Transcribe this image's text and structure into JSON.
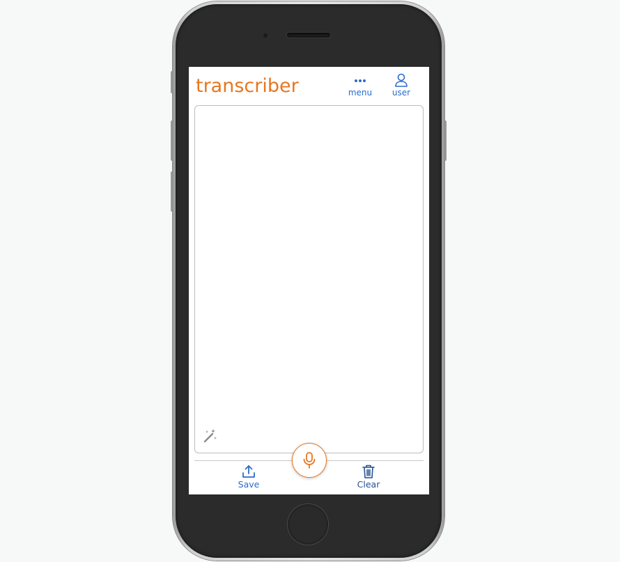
{
  "app": {
    "title": "transcriber"
  },
  "header": {
    "menu_label": "menu",
    "menu_icon": "more-horizontal-icon",
    "user_label": "user",
    "user_icon": "user-icon"
  },
  "editor": {
    "text": "",
    "tool_icon": "magic-wand-icon"
  },
  "toolbar": {
    "save_label": "Save",
    "save_icon": "upload-icon",
    "clear_label": "Clear",
    "clear_icon": "trash-icon",
    "record_icon": "microphone-icon"
  },
  "colors": {
    "accent": "#e8761f",
    "primary": "#2d6bc8",
    "clear_text": "#244f8f",
    "border": "#bdbdbd"
  }
}
